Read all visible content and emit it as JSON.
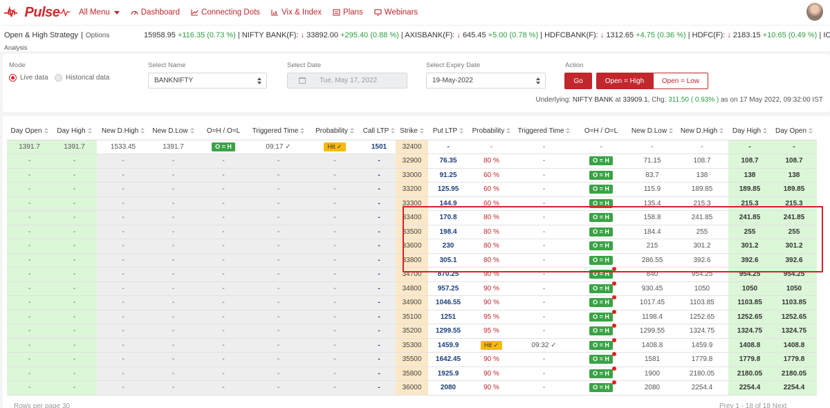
{
  "nav": {
    "logo": "Pulse",
    "all_menu": "All Menu",
    "links": [
      "Dashboard",
      "Connecting Dots",
      "Vix & Index",
      "Plans",
      "Webinars"
    ]
  },
  "subbar": {
    "title": "Open & High Strategy",
    "separator": "|",
    "section": "Options",
    "subtitle": "Analysis",
    "ticker": [
      {
        "symbol": "",
        "value": "15958.95",
        "change": "+116.35 (0.73 %)",
        "arrow": ""
      },
      {
        "symbol": "NIFTY BANK(F):",
        "value": "33892.00",
        "change": "+295.40 (0.88 %)",
        "arrow": "↓"
      },
      {
        "symbol": "AXISBANK(F):",
        "value": "645.45",
        "change": "+5.00 (0.78 %)",
        "arrow": "↓"
      },
      {
        "symbol": "HDFCBANK(F):",
        "value": "1312.65",
        "change": "+4.75 (0.36 %)",
        "arrow": "↓"
      },
      {
        "symbol": "HDFC(F):",
        "value": "2183.15",
        "change": "+10.65 (0.49 %)",
        "arrow": "↓"
      },
      {
        "symbol": "ICICIBA",
        "value": "",
        "change": "",
        "arrow": ""
      }
    ]
  },
  "filters": {
    "mode_label": "Mode",
    "mode_live": "Live data",
    "mode_hist": "Historical data",
    "name_label": "Select Name",
    "name_value": "BANKNIFTY",
    "date_label": "Select Date",
    "date_value": "Tue, May 17, 2022",
    "expiry_label": "Select Expiry Date",
    "expiry_value": "19-May-2022",
    "action_label": "Action",
    "go": "Go",
    "open_high": "Open = High",
    "open_low": "Open = Low",
    "underlying_prefix": "Underlying:",
    "underlying_name": "NIFTY BANK",
    "underlying_at": "at",
    "underlying_value": "33909.1",
    "chg_label": ", Chg:",
    "chg_value": "311.50 ( 0.93% )",
    "asof": "as on 17 May 2022, 09:32:00 IST"
  },
  "table": {
    "headers": [
      "Day Open",
      "Day High",
      "New D.High",
      "New D.Low",
      "O=H / O=L",
      "Triggered Time",
      "Probability",
      "Call LTP",
      "Strike",
      "Put LTP",
      "Probability",
      "Triggered Time",
      "O=H / O=L",
      "New D.Low",
      "New D.High",
      "Day High",
      "Day Open"
    ],
    "rows": [
      {
        "c_open": "1391.7",
        "c_high": "1391.7",
        "c_ndh": "1533.45",
        "c_ndl": "1391.7",
        "c_oh": "O = H",
        "c_time": "09:17 ✓",
        "c_prob": "Hit ✓",
        "c_ltp": "1501",
        "strike": "32400",
        "p_ltp": "-",
        "p_prob": "-",
        "p_time": "-",
        "p_oh": "-",
        "p_ndl": "-",
        "p_ndh": "-",
        "p_high": "-",
        "p_open": "-",
        "dot": false
      },
      {
        "c_open": "-",
        "c_high": "-",
        "c_ndh": "-",
        "c_ndl": "-",
        "c_oh": "-",
        "c_time": "-",
        "c_prob": "-",
        "c_ltp": "-",
        "strike": "32900",
        "p_ltp": "76.35",
        "p_prob": "80 %",
        "p_time": "-",
        "p_oh": "O = H",
        "p_ndl": "71.15",
        "p_ndh": "108.7",
        "p_high": "108.7",
        "p_open": "108.7",
        "dot": false
      },
      {
        "c_open": "-",
        "c_high": "-",
        "c_ndh": "-",
        "c_ndl": "-",
        "c_oh": "-",
        "c_time": "-",
        "c_prob": "-",
        "c_ltp": "-",
        "strike": "33000",
        "p_ltp": "91.25",
        "p_prob": "60 %",
        "p_time": "-",
        "p_oh": "O = H",
        "p_ndl": "83.7",
        "p_ndh": "138",
        "p_high": "138",
        "p_open": "138",
        "dot": false
      },
      {
        "c_open": "-",
        "c_high": "-",
        "c_ndh": "-",
        "c_ndl": "-",
        "c_oh": "-",
        "c_time": "-",
        "c_prob": "-",
        "c_ltp": "-",
        "strike": "33200",
        "p_ltp": "125.95",
        "p_prob": "60 %",
        "p_time": "-",
        "p_oh": "O = H",
        "p_ndl": "115.9",
        "p_ndh": "189.85",
        "p_high": "189.85",
        "p_open": "189.85",
        "dot": false
      },
      {
        "c_open": "-",
        "c_high": "-",
        "c_ndh": "-",
        "c_ndl": "-",
        "c_oh": "-",
        "c_time": "-",
        "c_prob": "-",
        "c_ltp": "-",
        "strike": "33300",
        "p_ltp": "144.9",
        "p_prob": "60 %",
        "p_time": "-",
        "p_oh": "O = H",
        "p_ndl": "135.4",
        "p_ndh": "215.3",
        "p_high": "215.3",
        "p_open": "215.3",
        "dot": false
      },
      {
        "c_open": "-",
        "c_high": "-",
        "c_ndh": "-",
        "c_ndl": "-",
        "c_oh": "-",
        "c_time": "-",
        "c_prob": "-",
        "c_ltp": "-",
        "strike": "33400",
        "p_ltp": "170.8",
        "p_prob": "80 %",
        "p_time": "-",
        "p_oh": "O = H",
        "p_ndl": "158.8",
        "p_ndh": "241.85",
        "p_high": "241.85",
        "p_open": "241.85",
        "dot": false
      },
      {
        "c_open": "-",
        "c_high": "-",
        "c_ndh": "-",
        "c_ndl": "-",
        "c_oh": "-",
        "c_time": "-",
        "c_prob": "-",
        "c_ltp": "-",
        "strike": "33500",
        "p_ltp": "198.4",
        "p_prob": "80 %",
        "p_time": "-",
        "p_oh": "O = H",
        "p_ndl": "184.4",
        "p_ndh": "255",
        "p_high": "255",
        "p_open": "255",
        "dot": false
      },
      {
        "c_open": "-",
        "c_high": "-",
        "c_ndh": "-",
        "c_ndl": "-",
        "c_oh": "-",
        "c_time": "-",
        "c_prob": "-",
        "c_ltp": "-",
        "strike": "33600",
        "p_ltp": "230",
        "p_prob": "80 %",
        "p_time": "-",
        "p_oh": "O = H",
        "p_ndl": "215",
        "p_ndh": "301.2",
        "p_high": "301.2",
        "p_open": "301.2",
        "dot": false
      },
      {
        "c_open": "-",
        "c_high": "-",
        "c_ndh": "-",
        "c_ndl": "-",
        "c_oh": "-",
        "c_time": "-",
        "c_prob": "-",
        "c_ltp": "-",
        "strike": "33800",
        "p_ltp": "305.1",
        "p_prob": "80 %",
        "p_time": "-",
        "p_oh": "O = H",
        "p_ndl": "286.55",
        "p_ndh": "392.6",
        "p_high": "392.6",
        "p_open": "392.6",
        "dot": false
      },
      {
        "c_open": "-",
        "c_high": "-",
        "c_ndh": "-",
        "c_ndl": "-",
        "c_oh": "-",
        "c_time": "-",
        "c_prob": "-",
        "c_ltp": "-",
        "strike": "34700",
        "p_ltp": "870.25",
        "p_prob": "90 %",
        "p_time": "-",
        "p_oh": "O = H",
        "p_ndl": "840",
        "p_ndh": "954.25",
        "p_high": "954.25",
        "p_open": "954.25",
        "dot": true
      },
      {
        "c_open": "-",
        "c_high": "-",
        "c_ndh": "-",
        "c_ndl": "-",
        "c_oh": "-",
        "c_time": "-",
        "c_prob": "-",
        "c_ltp": "-",
        "strike": "34800",
        "p_ltp": "957.25",
        "p_prob": "90 %",
        "p_time": "-",
        "p_oh": "O = H",
        "p_ndl": "930.45",
        "p_ndh": "1050",
        "p_high": "1050",
        "p_open": "1050",
        "dot": true
      },
      {
        "c_open": "-",
        "c_high": "-",
        "c_ndh": "-",
        "c_ndl": "-",
        "c_oh": "-",
        "c_time": "-",
        "c_prob": "-",
        "c_ltp": "-",
        "strike": "34900",
        "p_ltp": "1046.55",
        "p_prob": "90 %",
        "p_time": "-",
        "p_oh": "O = H",
        "p_ndl": "1017.45",
        "p_ndh": "1103.85",
        "p_high": "1103.85",
        "p_open": "1103.85",
        "dot": true
      },
      {
        "c_open": "-",
        "c_high": "-",
        "c_ndh": "-",
        "c_ndl": "-",
        "c_oh": "-",
        "c_time": "-",
        "c_prob": "-",
        "c_ltp": "-",
        "strike": "35100",
        "p_ltp": "1251",
        "p_prob": "95 %",
        "p_time": "-",
        "p_oh": "O = H",
        "p_ndl": "1198.4",
        "p_ndh": "1252.65",
        "p_high": "1252.65",
        "p_open": "1252.65",
        "dot": true
      },
      {
        "c_open": "-",
        "c_high": "-",
        "c_ndh": "-",
        "c_ndl": "-",
        "c_oh": "-",
        "c_time": "-",
        "c_prob": "-",
        "c_ltp": "-",
        "strike": "35200",
        "p_ltp": "1299.55",
        "p_prob": "95 %",
        "p_time": "-",
        "p_oh": "O = H",
        "p_ndl": "1299.55",
        "p_ndh": "1324.75",
        "p_high": "1324.75",
        "p_open": "1324.75",
        "dot": true
      },
      {
        "c_open": "-",
        "c_high": "-",
        "c_ndh": "-",
        "c_ndl": "-",
        "c_oh": "-",
        "c_time": "-",
        "c_prob": "-",
        "c_ltp": "-",
        "strike": "35300",
        "p_ltp": "1459.9",
        "p_prob": "Hit ✓",
        "p_time": "09:32 ✓",
        "p_oh": "O = H",
        "p_ndl": "1408.8",
        "p_ndh": "1459.9",
        "p_high": "1408.8",
        "p_open": "1408.8",
        "dot": true
      },
      {
        "c_open": "-",
        "c_high": "-",
        "c_ndh": "-",
        "c_ndl": "-",
        "c_oh": "-",
        "c_time": "-",
        "c_prob": "-",
        "c_ltp": "-",
        "strike": "35500",
        "p_ltp": "1642.45",
        "p_prob": "90 %",
        "p_time": "-",
        "p_oh": "O = H",
        "p_ndl": "1581",
        "p_ndh": "1779.8",
        "p_high": "1779.8",
        "p_open": "1779.8",
        "dot": true
      },
      {
        "c_open": "-",
        "c_high": "-",
        "c_ndh": "-",
        "c_ndl": "-",
        "c_oh": "-",
        "c_time": "-",
        "c_prob": "-",
        "c_ltp": "-",
        "strike": "35800",
        "p_ltp": "1925.9",
        "p_prob": "90 %",
        "p_time": "-",
        "p_oh": "O = H",
        "p_ndl": "1900",
        "p_ndh": "2180.05",
        "p_high": "2180.05",
        "p_open": "2180.05",
        "dot": true
      },
      {
        "c_open": "-",
        "c_high": "-",
        "c_ndh": "-",
        "c_ndl": "-",
        "c_oh": "-",
        "c_time": "-",
        "c_prob": "-",
        "c_ltp": "-",
        "strike": "36000",
        "p_ltp": "2080",
        "p_prob": "90 %",
        "p_time": "-",
        "p_oh": "O = H",
        "p_ndl": "2080",
        "p_ndh": "2254.4",
        "p_high": "2254.4",
        "p_open": "2254.4",
        "dot": true
      }
    ]
  },
  "footer": {
    "rows_per_page": "Rows per page",
    "rpp_value": "30",
    "prev": "Prev",
    "range": "1 - 18 of 18",
    "next": "Next"
  }
}
